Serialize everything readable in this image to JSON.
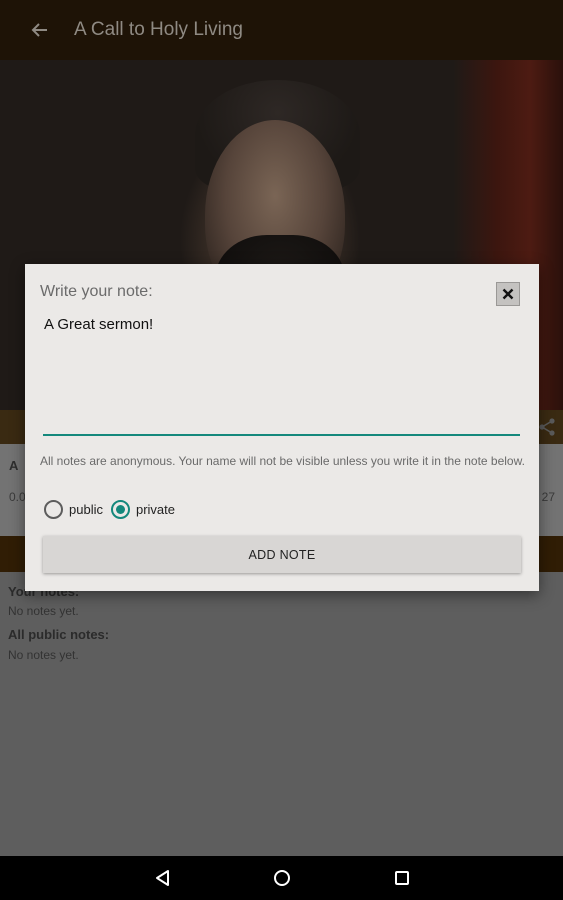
{
  "appbar": {
    "title": "A Call to Holy Living",
    "back_icon": "arrow-left-icon"
  },
  "background": {
    "info_first_line": "A",
    "info_left_value": "0.0",
    "info_right_value": "27",
    "your_notes_heading": "Your notes:",
    "your_notes_empty": "No notes yet.",
    "public_notes_heading": "All public notes:",
    "public_notes_empty": "No notes yet."
  },
  "dialog": {
    "title": "Write your note:",
    "note_value": "A Great sermon!",
    "disclaimer": "All notes are anonymous. Your name will not be visible unless you write it in the note below.",
    "visibility_options": [
      {
        "label": "public",
        "selected": false
      },
      {
        "label": "private",
        "selected": true
      }
    ],
    "add_button_label": "ADD NOTE",
    "accent_color": "#14887c"
  },
  "navbar": {
    "icons": [
      "back-triangle-icon",
      "home-circle-icon",
      "recents-square-icon"
    ]
  }
}
